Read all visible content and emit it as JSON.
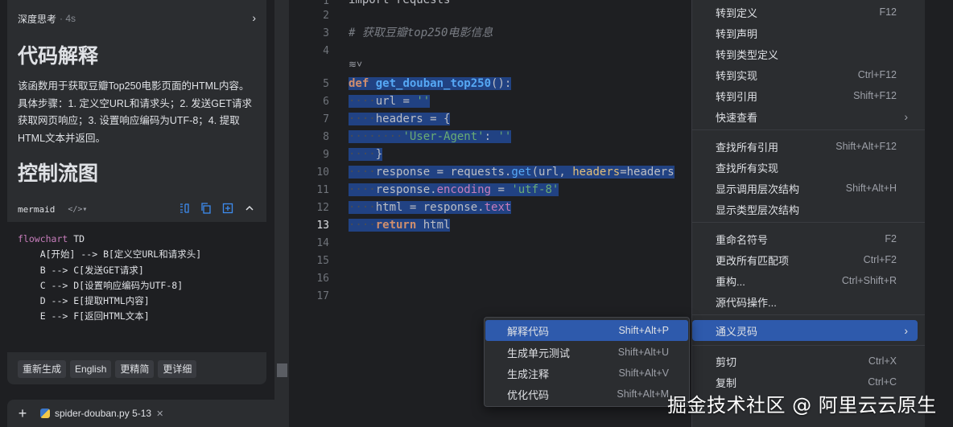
{
  "chat": {
    "think_label": "深度思考",
    "think_duration": "· 4s",
    "heading_explain": "代码解释",
    "explain_text": "该函数用于获取豆瓣Top250电影页面的HTML内容。具体步骤：1. 定义空URL和请求头；2. 发送GET请求获取网页响应；3. 设置响应编码为UTF-8；4. 提取HTML文本并返回。",
    "heading_flow": "控制流图",
    "code_lang": "mermaid",
    "code_lang_switch": "</>▾",
    "code_lines": [
      {
        "kw": "flowchart",
        "rest": " TD"
      },
      {
        "kw": "",
        "rest": "    A[开始] --> B[定义空URL和请求头]"
      },
      {
        "kw": "",
        "rest": "    B --> C[发送GET请求]"
      },
      {
        "kw": "",
        "rest": "    C --> D[设置响应编码为UTF-8]"
      },
      {
        "kw": "",
        "rest": "    D --> E[提取HTML内容]"
      },
      {
        "kw": "",
        "rest": "    E --> F[返回HTML文本]"
      }
    ],
    "actions": [
      "重新生成",
      "English",
      "更精简",
      "更详细"
    ],
    "attachment": "spider-douban.py 5-13"
  },
  "editor": {
    "line_numbers": [
      "1",
      "2",
      "3",
      "4",
      "5",
      "6",
      "7",
      "8",
      "9",
      "10",
      "11",
      "12",
      "13",
      "14",
      "15",
      "16",
      "17"
    ],
    "current_line": "13",
    "top_fragment": "import requests",
    "comment": "# 获取豆瓣top250电影信息",
    "code": {
      "l5_kw": "def",
      "l5_fn": "get_douban_top250",
      "l5_rest": "():",
      "l6_a": "url",
      "l6_b": " = ",
      "l6_c": "''",
      "l7_a": "headers",
      "l7_b": " = {",
      "l8_c": "'User-Agent'",
      "l8_d": ": ",
      "l8_e": "''",
      "l9": "}",
      "l10_a": "response",
      "l10_b": " = requests.",
      "l10_c": "get",
      "l10_d": "(url, ",
      "l10_e": "headers",
      "l10_f": "=headers",
      "l11_a": "response.",
      "l11_b": "encoding",
      "l11_c": " = ",
      "l11_d": "'utf-8'",
      "l12_a": "html",
      "l12_b": " = response.",
      "l12_c": "text",
      "l13_a": "return",
      "l13_b": " html"
    }
  },
  "context_menu": {
    "items": [
      {
        "label": "转到定义",
        "shortcut": "F12"
      },
      {
        "label": "转到声明",
        "shortcut": ""
      },
      {
        "label": "转到类型定义",
        "shortcut": ""
      },
      {
        "label": "转到实现",
        "shortcut": "Ctrl+F12"
      },
      {
        "label": "转到引用",
        "shortcut": "Shift+F12"
      },
      {
        "label": "快速查看",
        "shortcut": ""
      },
      {
        "label": "查找所有引用",
        "shortcut": "Shift+Alt+F12"
      },
      {
        "label": "查找所有实现",
        "shortcut": ""
      },
      {
        "label": "显示调用层次结构",
        "shortcut": "Shift+Alt+H"
      },
      {
        "label": "显示类型层次结构",
        "shortcut": ""
      },
      {
        "label": "重命名符号",
        "shortcut": "F2"
      },
      {
        "label": "更改所有匹配项",
        "shortcut": "Ctrl+F2"
      },
      {
        "label": "重构...",
        "shortcut": "Ctrl+Shift+R"
      },
      {
        "label": "源代码操作...",
        "shortcut": ""
      },
      {
        "label": "通义灵码",
        "shortcut": ""
      },
      {
        "label": "剪切",
        "shortcut": "Ctrl+X"
      },
      {
        "label": "复制",
        "shortcut": "Ctrl+C"
      }
    ]
  },
  "submenu": {
    "items": [
      {
        "label": "解释代码",
        "shortcut": "Shift+Alt+P"
      },
      {
        "label": "生成单元测试",
        "shortcut": "Shift+Alt+U"
      },
      {
        "label": "生成注释",
        "shortcut": "Shift+Alt+V"
      },
      {
        "label": "优化代码",
        "shortcut": "Shift+Alt+M"
      }
    ]
  },
  "watermark": "掘金技术社区 @ 阿里云云原生",
  "colors": {
    "accent": "#2e5aac",
    "selection": "#214283",
    "link_icon": "#3d8cf0"
  }
}
